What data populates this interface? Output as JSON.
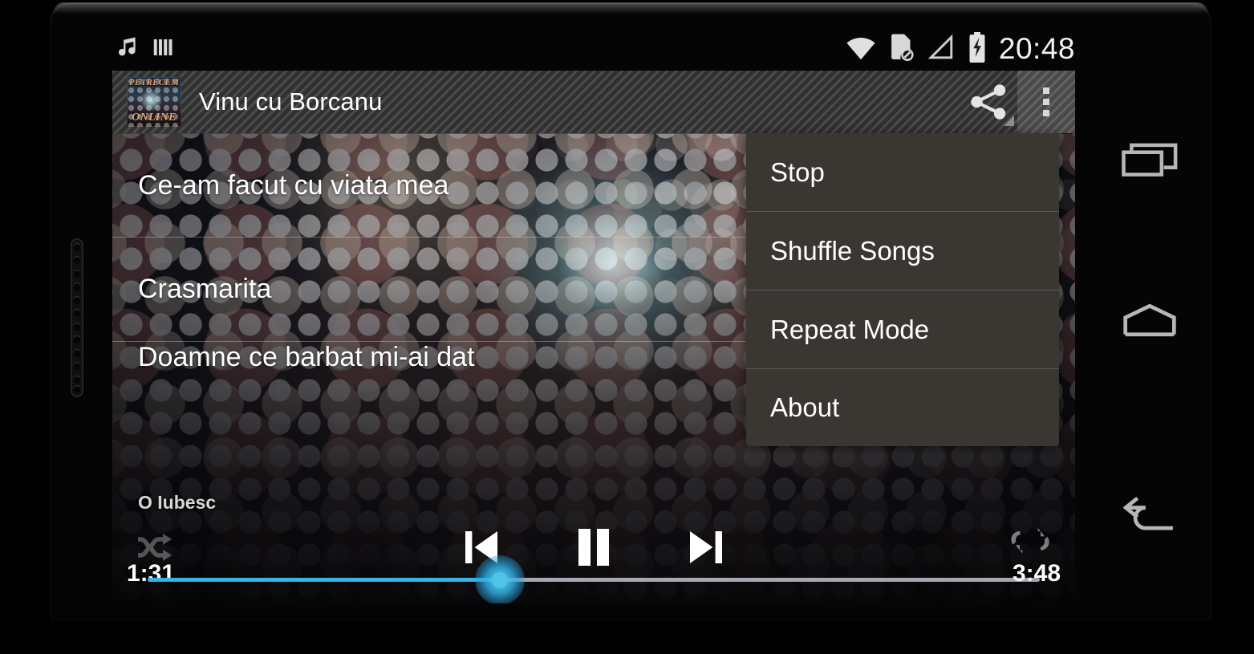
{
  "status_bar": {
    "icons": [
      "music-note-icon",
      "equalizer-icon",
      "wifi-icon",
      "sdcard-disabled-icon",
      "signal-empty-icon",
      "battery-charging-icon"
    ],
    "clock": "20:48"
  },
  "action_bar": {
    "album_art_line1": "PETRECEM",
    "album_art_line2": "ONLINE",
    "title": "Vinu cu Borcanu",
    "share_label": "share-icon",
    "overflow_label": "overflow-menu-icon"
  },
  "song_list": [
    {
      "title": "Ce-am facut cu viata mea"
    },
    {
      "title": "Crasmarita"
    },
    {
      "title": "Doamne ce barbat mi-ai dat"
    }
  ],
  "player": {
    "now_playing": "O Iubesc",
    "current_time": "1:31",
    "total_time": "3:48",
    "progress_percent": 39.5,
    "shuffle_state": "off",
    "repeat_state": "off",
    "playback_state": "playing",
    "accent_color": "#33b5e5",
    "prev_label": "previous-track-icon",
    "pause_label": "pause-icon",
    "next_label": "next-track-icon",
    "shuffle_label": "shuffle-icon",
    "repeat_label": "repeat-icon"
  },
  "overflow_menu": {
    "items": [
      {
        "label": "Stop"
      },
      {
        "label": "Shuffle Songs"
      },
      {
        "label": "Repeat Mode"
      },
      {
        "label": "About"
      }
    ]
  },
  "nav_bar": {
    "recents_label": "recents-icon",
    "home_label": "home-icon",
    "back_label": "back-icon"
  }
}
